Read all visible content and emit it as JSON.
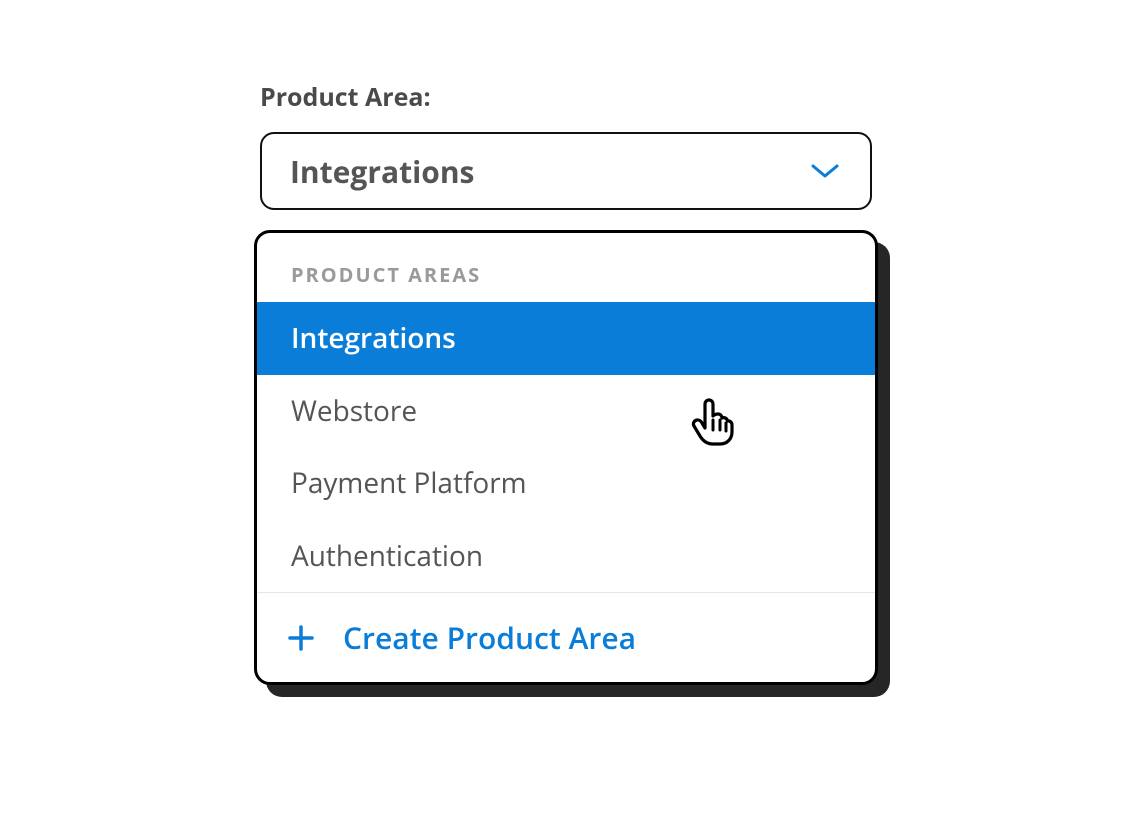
{
  "field": {
    "label": "Product Area:"
  },
  "select": {
    "value": "Integrations"
  },
  "dropdown": {
    "header": "PRODUCT AREAS",
    "items": [
      {
        "label": "Integrations",
        "selected": true
      },
      {
        "label": "Webstore",
        "selected": false
      },
      {
        "label": "Payment Platform",
        "selected": false
      },
      {
        "label": "Authentication",
        "selected": false
      }
    ],
    "create_label": "Create Product Area"
  },
  "colors": {
    "accent": "#0a7dd8",
    "text": "#555555",
    "muted": "#9a9a9a",
    "border": "#000000"
  }
}
